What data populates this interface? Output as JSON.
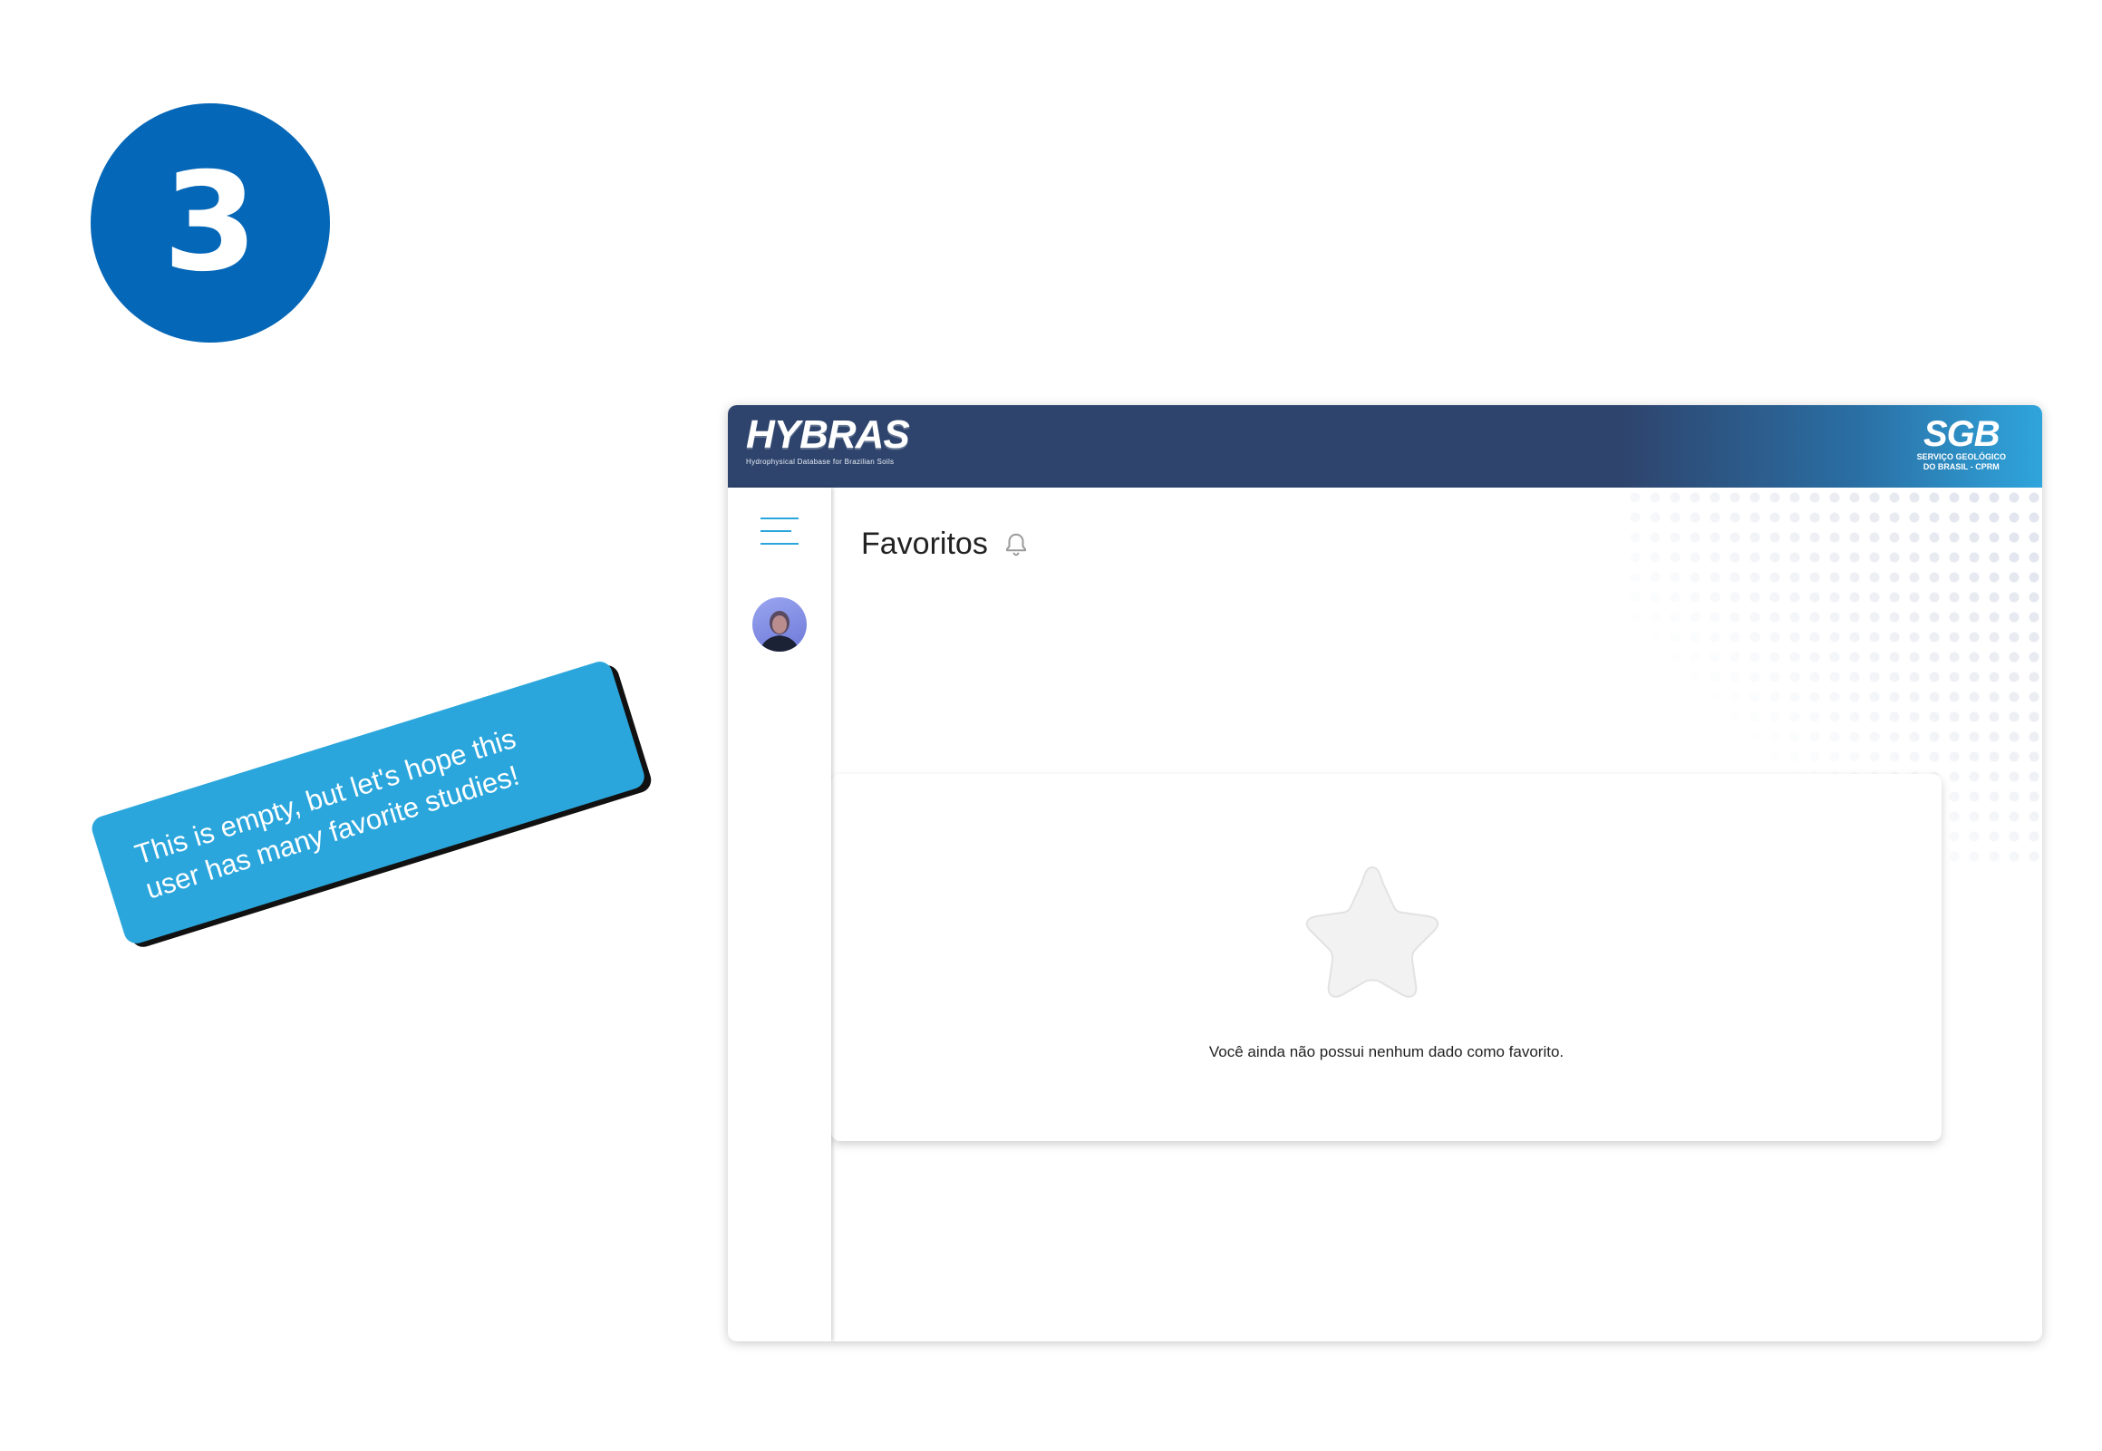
{
  "step": {
    "number": "3",
    "color": "#0567b7"
  },
  "callout": {
    "line1": "This is empty, but let's hope this",
    "line2": "user has many favorite studies!"
  },
  "header": {
    "brand_name": "HYBRAS",
    "brand_subtitle": "Hydrophysical Database for Brazilian Soils",
    "partner_name": "SGB",
    "partner_line1": "SERVIÇO GEOLÓGICO",
    "partner_line2": "DO BRASIL - CPRM",
    "colors": {
      "dark": "#2e446d",
      "light": "#2fa5dc"
    }
  },
  "sidebar": {
    "menu_icon": "hamburger-menu-icon",
    "avatar": "user-avatar"
  },
  "main": {
    "title": "Favoritos",
    "title_icon": "bell-icon",
    "empty_state": {
      "icon": "star-icon",
      "message": "Você ainda não possui nenhum dado como favorito."
    }
  }
}
